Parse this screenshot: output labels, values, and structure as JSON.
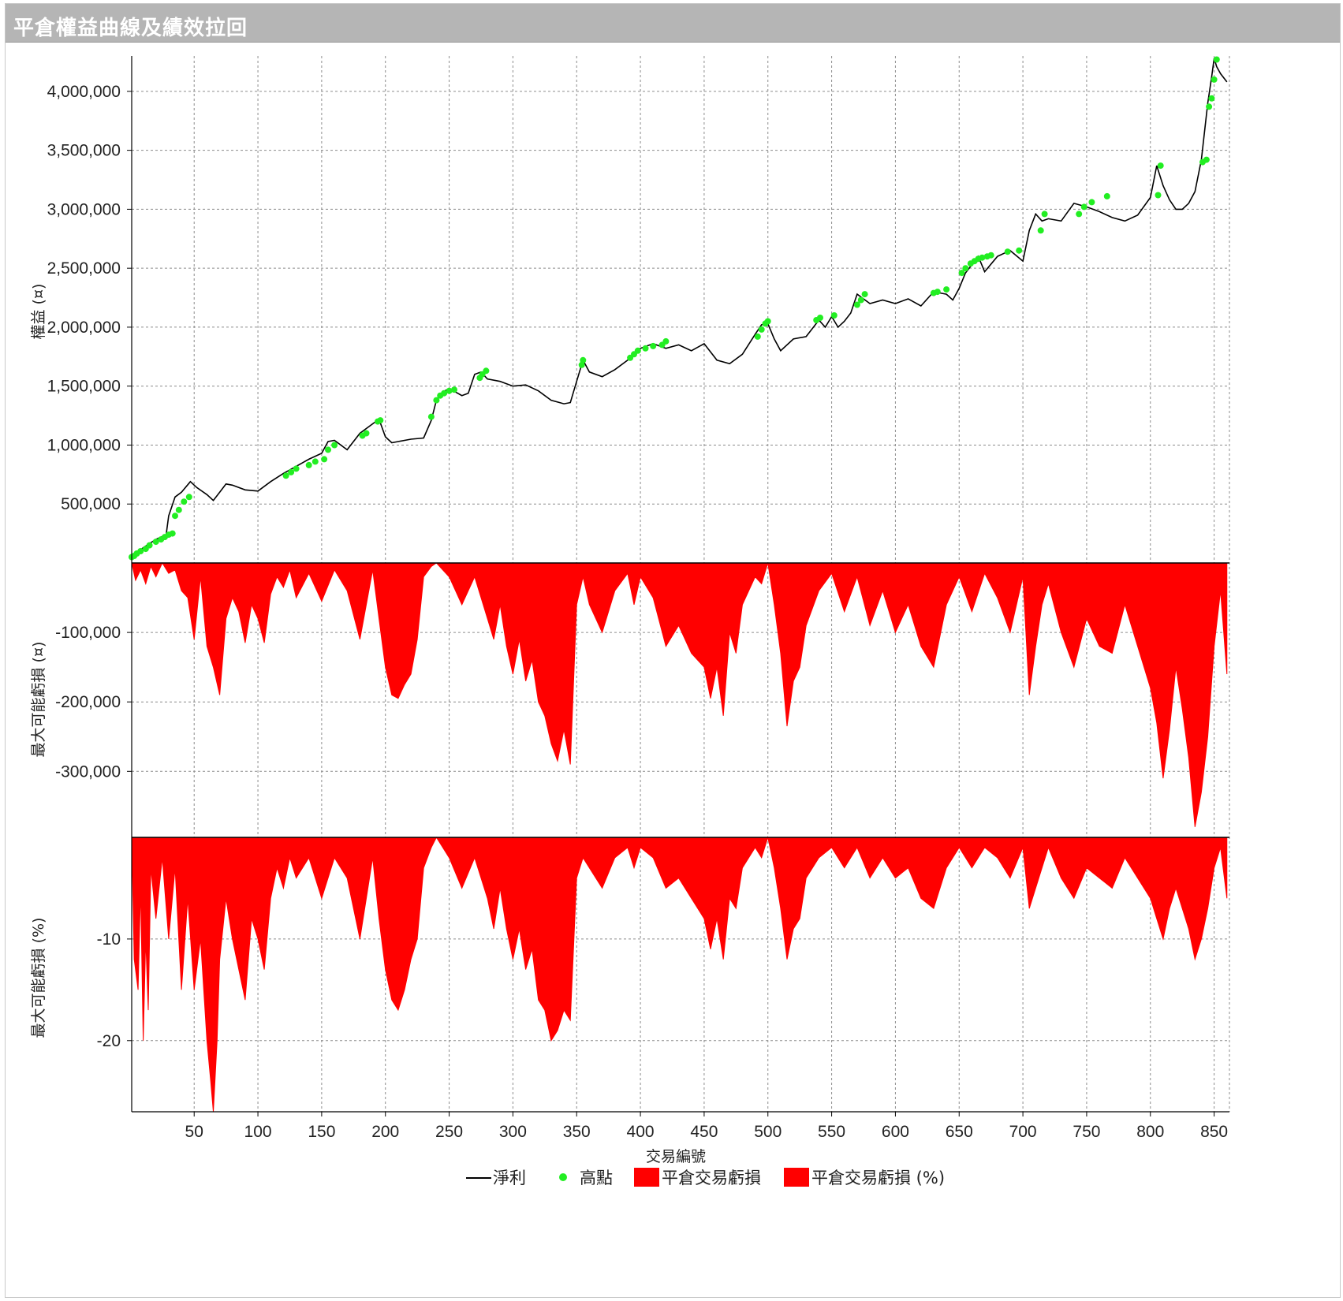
{
  "window": {
    "title": "平倉權益曲線及績效拉回"
  },
  "colors": {
    "line": "#000000",
    "highs": "#22ee22",
    "drawdown": "#ff0000",
    "grid": "#8c8c8c"
  },
  "chart_data": [
    {
      "type": "line",
      "ylabel": "權益 (¤)",
      "xlim": [
        1,
        862
      ],
      "ylim": [
        0,
        4300000
      ],
      "yticks": [
        500000,
        1000000,
        1500000,
        2000000,
        2500000,
        3000000,
        3500000,
        4000000
      ],
      "ytick_labels": [
        "500,000",
        "1,000,000",
        "1,500,000",
        "2,000,000",
        "2,500,000",
        "3,000,000",
        "3,500,000",
        "4,000,000"
      ],
      "series": [
        {
          "name": "淨利",
          "x": [
            1,
            10,
            20,
            28,
            30,
            35,
            40,
            47,
            52,
            60,
            65,
            70,
            75,
            80,
            90,
            100,
            110,
            120,
            130,
            140,
            150,
            155,
            160,
            170,
            180,
            190,
            195,
            200,
            205,
            210,
            220,
            230,
            236,
            240,
            245,
            250,
            260,
            265,
            270,
            275,
            280,
            290,
            300,
            310,
            320,
            330,
            340,
            345,
            350,
            355,
            360,
            370,
            380,
            390,
            400,
            410,
            420,
            430,
            440,
            450,
            460,
            470,
            480,
            490,
            495,
            500,
            505,
            510,
            520,
            530,
            540,
            545,
            550,
            555,
            560,
            565,
            570,
            580,
            590,
            600,
            610,
            620,
            630,
            640,
            645,
            650,
            655,
            660,
            665,
            670,
            680,
            690,
            700,
            705,
            710,
            715,
            720,
            730,
            740,
            750,
            760,
            770,
            780,
            790,
            800,
            805,
            810,
            815,
            820,
            825,
            830,
            835,
            840,
            845,
            848,
            850,
            852,
            855,
            860
          ],
          "y": [
            50000,
            130000,
            200000,
            240000,
            400000,
            560000,
            600000,
            690000,
            640000,
            580000,
            530000,
            600000,
            670000,
            660000,
            620000,
            610000,
            690000,
            760000,
            820000,
            880000,
            930000,
            1030000,
            1040000,
            960000,
            1100000,
            1180000,
            1220000,
            1070000,
            1020000,
            1030000,
            1050000,
            1060000,
            1210000,
            1380000,
            1450000,
            1480000,
            1420000,
            1440000,
            1600000,
            1620000,
            1560000,
            1540000,
            1500000,
            1510000,
            1460000,
            1380000,
            1350000,
            1360000,
            1540000,
            1720000,
            1620000,
            1580000,
            1640000,
            1720000,
            1820000,
            1860000,
            1820000,
            1850000,
            1800000,
            1860000,
            1720000,
            1690000,
            1770000,
            1940000,
            2020000,
            2030000,
            1900000,
            1800000,
            1900000,
            1920000,
            2060000,
            2000000,
            2090000,
            2000000,
            2050000,
            2120000,
            2280000,
            2200000,
            2230000,
            2200000,
            2240000,
            2180000,
            2300000,
            2280000,
            2230000,
            2330000,
            2460000,
            2530000,
            2600000,
            2470000,
            2600000,
            2650000,
            2560000,
            2820000,
            2960000,
            2900000,
            2920000,
            2900000,
            3050000,
            3020000,
            2980000,
            2930000,
            2900000,
            2950000,
            3100000,
            3370000,
            3200000,
            3080000,
            3000000,
            3000000,
            3050000,
            3150000,
            3420000,
            3900000,
            4120000,
            4280000,
            4210000,
            4150000,
            4080000
          ]
        },
        {
          "name": "高點",
          "x": [
            1,
            3,
            5,
            8,
            12,
            15,
            20,
            24,
            27,
            30,
            33,
            35,
            38,
            42,
            46,
            122,
            126,
            130,
            140,
            145,
            152,
            155,
            160,
            182,
            185,
            194,
            196,
            236,
            240,
            243,
            246,
            250,
            254,
            274,
            276,
            279,
            354,
            355,
            392,
            395,
            398,
            404,
            410,
            417,
            420,
            492,
            495,
            498,
            500,
            538,
            541,
            552,
            570,
            573,
            576,
            630,
            633,
            640,
            652,
            655,
            659,
            662,
            665,
            668,
            672,
            675,
            688,
            697,
            714,
            717,
            744,
            748,
            754,
            766,
            806,
            808,
            841,
            844,
            846,
            848,
            850,
            852
          ],
          "y": [
            50000,
            60000,
            80000,
            100000,
            120000,
            150000,
            180000,
            200000,
            220000,
            240000,
            250000,
            400000,
            450000,
            520000,
            560000,
            740000,
            770000,
            800000,
            830000,
            860000,
            880000,
            960000,
            1000000,
            1080000,
            1100000,
            1200000,
            1210000,
            1240000,
            1380000,
            1420000,
            1440000,
            1460000,
            1470000,
            1570000,
            1600000,
            1630000,
            1680000,
            1720000,
            1740000,
            1770000,
            1800000,
            1820000,
            1840000,
            1850000,
            1880000,
            1920000,
            1980000,
            2030000,
            2050000,
            2060000,
            2080000,
            2100000,
            2190000,
            2230000,
            2280000,
            2290000,
            2300000,
            2320000,
            2460000,
            2500000,
            2540000,
            2560000,
            2580000,
            2590000,
            2600000,
            2610000,
            2640000,
            2650000,
            2820000,
            2960000,
            2960000,
            3020000,
            3060000,
            3110000,
            3120000,
            3370000,
            3400000,
            3420000,
            3870000,
            3940000,
            4100000,
            4270000
          ]
        }
      ]
    },
    {
      "type": "area",
      "ylabel": "最大可能虧損 (¤)",
      "ylim": [
        -395000,
        0
      ],
      "yticks": [
        -100000,
        -200000,
        -300000
      ],
      "ytick_labels": [
        "-100,000",
        "-200,000",
        "-300,000"
      ],
      "series": [
        {
          "name": "平倉交易虧損",
          "x": [
            1,
            4,
            8,
            12,
            16,
            20,
            25,
            30,
            35,
            40,
            45,
            50,
            55,
            60,
            65,
            70,
            75,
            80,
            85,
            90,
            95,
            100,
            105,
            110,
            115,
            120,
            125,
            130,
            140,
            150,
            160,
            170,
            180,
            190,
            195,
            200,
            205,
            210,
            215,
            220,
            225,
            230,
            236,
            240,
            250,
            260,
            270,
            280,
            285,
            290,
            295,
            300,
            305,
            310,
            315,
            320,
            325,
            330,
            335,
            340,
            345,
            350,
            355,
            360,
            370,
            380,
            390,
            395,
            400,
            410,
            420,
            430,
            440,
            450,
            455,
            460,
            465,
            470,
            475,
            480,
            490,
            495,
            500,
            505,
            510,
            515,
            520,
            525,
            530,
            540,
            550,
            560,
            570,
            580,
            590,
            600,
            610,
            620,
            630,
            640,
            650,
            660,
            670,
            680,
            690,
            700,
            705,
            710,
            715,
            720,
            730,
            740,
            750,
            760,
            770,
            780,
            790,
            800,
            805,
            810,
            815,
            820,
            825,
            830,
            835,
            840,
            845,
            850,
            855,
            860
          ],
          "y": [
            0,
            -25000,
            -10000,
            -30000,
            -5000,
            -20000,
            0,
            -15000,
            -10000,
            -40000,
            -50000,
            -110000,
            -20000,
            -120000,
            -150000,
            -190000,
            -80000,
            -50000,
            -70000,
            -115000,
            -60000,
            -80000,
            -115000,
            -45000,
            -20000,
            -35000,
            -10000,
            -50000,
            -15000,
            -55000,
            -10000,
            -40000,
            -110000,
            -10000,
            -80000,
            -150000,
            -190000,
            -195000,
            -175000,
            -160000,
            -110000,
            -20000,
            -5000,
            0,
            -20000,
            -60000,
            -20000,
            -80000,
            -110000,
            -60000,
            -120000,
            -160000,
            -110000,
            -170000,
            -140000,
            -200000,
            -220000,
            -260000,
            -285000,
            -240000,
            -290000,
            -60000,
            -20000,
            -60000,
            -100000,
            -40000,
            -15000,
            -60000,
            -20000,
            -50000,
            -120000,
            -90000,
            -130000,
            -150000,
            -195000,
            -150000,
            -220000,
            -100000,
            -130000,
            -60000,
            -20000,
            -30000,
            0,
            -60000,
            -130000,
            -235000,
            -170000,
            -150000,
            -90000,
            -40000,
            -15000,
            -70000,
            -20000,
            -90000,
            -40000,
            -100000,
            -60000,
            -120000,
            -150000,
            -60000,
            -20000,
            -70000,
            -15000,
            -50000,
            -100000,
            -20000,
            -190000,
            -120000,
            -60000,
            -30000,
            -100000,
            -150000,
            -80000,
            -120000,
            -130000,
            -60000,
            -120000,
            -180000,
            -230000,
            -310000,
            -240000,
            -150000,
            -210000,
            -280000,
            -380000,
            -330000,
            -250000,
            -120000,
            -40000,
            -160000
          ]
        }
      ]
    },
    {
      "type": "area",
      "ylabel": "最大可能虧損 (%)",
      "xlabel": "交易編號",
      "ylim": [
        -27,
        0
      ],
      "yticks": [
        -10,
        -20
      ],
      "ytick_labels": [
        "-10",
        "-20"
      ],
      "xticks": [
        50,
        100,
        150,
        200,
        250,
        300,
        350,
        400,
        450,
        500,
        550,
        600,
        650,
        700,
        750,
        800,
        850
      ],
      "xtick_labels": [
        "50",
        "100",
        "150",
        "200",
        "250",
        "300",
        "350",
        "400",
        "450",
        "500",
        "550",
        "600",
        "650",
        "700",
        "750",
        "800",
        "850"
      ],
      "series": [
        {
          "name": "平倉交易虧損 (%)",
          "x": [
            1,
            3,
            6,
            8,
            10,
            12,
            14,
            16,
            20,
            25,
            30,
            35,
            40,
            45,
            50,
            55,
            60,
            63,
            65,
            68,
            70,
            75,
            80,
            85,
            90,
            95,
            100,
            105,
            110,
            115,
            120,
            125,
            130,
            140,
            150,
            160,
            170,
            180,
            190,
            195,
            200,
            205,
            210,
            215,
            220,
            225,
            230,
            236,
            240,
            250,
            260,
            270,
            280,
            285,
            290,
            295,
            300,
            305,
            310,
            315,
            320,
            325,
            330,
            335,
            340,
            345,
            350,
            355,
            360,
            370,
            380,
            390,
            395,
            400,
            410,
            420,
            430,
            440,
            450,
            455,
            460,
            465,
            470,
            475,
            480,
            490,
            495,
            500,
            505,
            510,
            515,
            520,
            525,
            530,
            540,
            550,
            560,
            570,
            580,
            590,
            600,
            610,
            620,
            630,
            640,
            650,
            660,
            670,
            680,
            690,
            700,
            705,
            710,
            715,
            720,
            730,
            740,
            750,
            760,
            770,
            780,
            790,
            800,
            805,
            810,
            815,
            820,
            825,
            830,
            835,
            840,
            845,
            850,
            855,
            860
          ],
          "y": [
            0,
            -12,
            -15,
            -5,
            -20,
            -10,
            -17,
            -3,
            -8,
            -2,
            -10,
            -3,
            -15,
            -6,
            -15,
            -10,
            -20,
            -24,
            -27,
            -20,
            -12,
            -6,
            -10,
            -13,
            -16,
            -8,
            -10,
            -13,
            -6,
            -3,
            -5,
            -2,
            -4,
            -2,
            -6,
            -2,
            -4,
            -10,
            -2,
            -8,
            -13,
            -16,
            -17,
            -15,
            -12,
            -10,
            -3,
            -1,
            0,
            -2,
            -5,
            -2,
            -6,
            -9,
            -5,
            -9,
            -12,
            -9,
            -13,
            -11,
            -16,
            -17,
            -20,
            -19,
            -17,
            -18,
            -4,
            -2,
            -3,
            -5,
            -2,
            -1,
            -3,
            -1,
            -2,
            -5,
            -4,
            -6,
            -8,
            -11,
            -8,
            -12,
            -6,
            -7,
            -3,
            -1,
            -2,
            0,
            -3,
            -7,
            -12,
            -9,
            -8,
            -4,
            -2,
            -1,
            -3,
            -1,
            -4,
            -2,
            -4,
            -3,
            -6,
            -7,
            -3,
            -1,
            -3,
            -1,
            -2,
            -4,
            -1,
            -7,
            -5,
            -3,
            -1,
            -4,
            -6,
            -3,
            -4,
            -5,
            -2,
            -4,
            -6,
            -8,
            -10,
            -7,
            -5,
            -7,
            -9,
            -12,
            -10,
            -7,
            -3,
            -1,
            -6
          ]
        }
      ]
    }
  ],
  "legend": {
    "items": [
      {
        "label": "淨利"
      },
      {
        "label": "高點"
      },
      {
        "label": "平倉交易虧損"
      },
      {
        "label": "平倉交易虧損 (%)"
      }
    ]
  }
}
